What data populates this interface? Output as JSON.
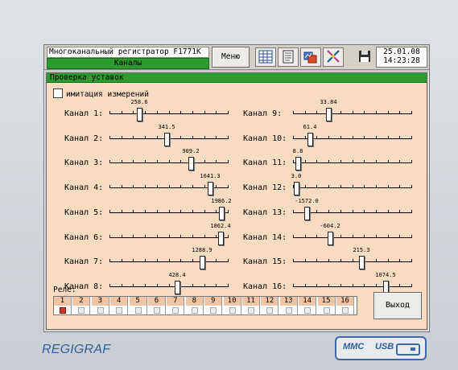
{
  "app": {
    "title": "Многоканальный регистратор F1771К",
    "subtitle": "Каналы",
    "menu_label": "Меню",
    "date": "25.01.08",
    "time": "14:23:28"
  },
  "toolbar_icons": [
    "table-icon",
    "document-icon",
    "charts-icon",
    "measure-tool-icon"
  ],
  "panel": {
    "title": "Проверка уставок",
    "simulate_label": "имитация измерений",
    "simulate_checked": false,
    "relays_label": "Реле:",
    "exit_label": "Выход"
  },
  "channels": [
    {
      "label": "Канал 1:",
      "value": "258.6",
      "fraction": 0.24
    },
    {
      "label": "Канал 2:",
      "value": "341.5",
      "fraction": 0.48
    },
    {
      "label": "Канал 3:",
      "value": "909.2",
      "fraction": 0.69
    },
    {
      "label": "Канал 4:",
      "value": "1641.3",
      "fraction": 0.86
    },
    {
      "label": "Канал 5:",
      "value": "1986.2",
      "fraction": 0.96
    },
    {
      "label": "Канал 6:",
      "value": "1862.4",
      "fraction": 0.95
    },
    {
      "label": "Канал 7:",
      "value": "1288.9",
      "fraction": 0.79
    },
    {
      "label": "Канал 8:",
      "value": "428.4",
      "fraction": 0.57
    },
    {
      "label": "Канал 9:",
      "value": "33.84",
      "fraction": 0.29
    },
    {
      "label": "Канал 10:",
      "value": "61.4",
      "fraction": 0.13
    },
    {
      "label": "Канал 11:",
      "value": "8.8",
      "fraction": 0.02
    },
    {
      "label": "Канал 12:",
      "value": "3.0",
      "fraction": 0.01
    },
    {
      "label": "Канал 13:",
      "value": "-1572.0",
      "fraction": 0.1
    },
    {
      "label": "Канал 14:",
      "value": "-604.2",
      "fraction": 0.3
    },
    {
      "label": "Канал 15:",
      "value": "215.3",
      "fraction": 0.58
    },
    {
      "label": "Канал 16:",
      "value": "1074.5",
      "fraction": 0.79
    }
  ],
  "relays": [
    {
      "num": "1",
      "on": true
    },
    {
      "num": "2",
      "on": false
    },
    {
      "num": "3",
      "on": false
    },
    {
      "num": "4",
      "on": false
    },
    {
      "num": "5",
      "on": false
    },
    {
      "num": "6",
      "on": false
    },
    {
      "num": "7",
      "on": false
    },
    {
      "num": "8",
      "on": false
    },
    {
      "num": "9",
      "on": false
    },
    {
      "num": "10",
      "on": false
    },
    {
      "num": "11",
      "on": false
    },
    {
      "num": "12",
      "on": false
    },
    {
      "num": "13",
      "on": false
    },
    {
      "num": "14",
      "on": false
    },
    {
      "num": "15",
      "on": false
    },
    {
      "num": "16",
      "on": false
    }
  ],
  "device": {
    "brand": "REGIGRAF",
    "port_mmc": "MMC",
    "port_usb": "USB"
  },
  "colors": {
    "panel_bg": "#f7dcc1",
    "header_green": "#2d9a2d",
    "relay_on": "#d8321e",
    "brand_blue": "#2f5f99"
  }
}
